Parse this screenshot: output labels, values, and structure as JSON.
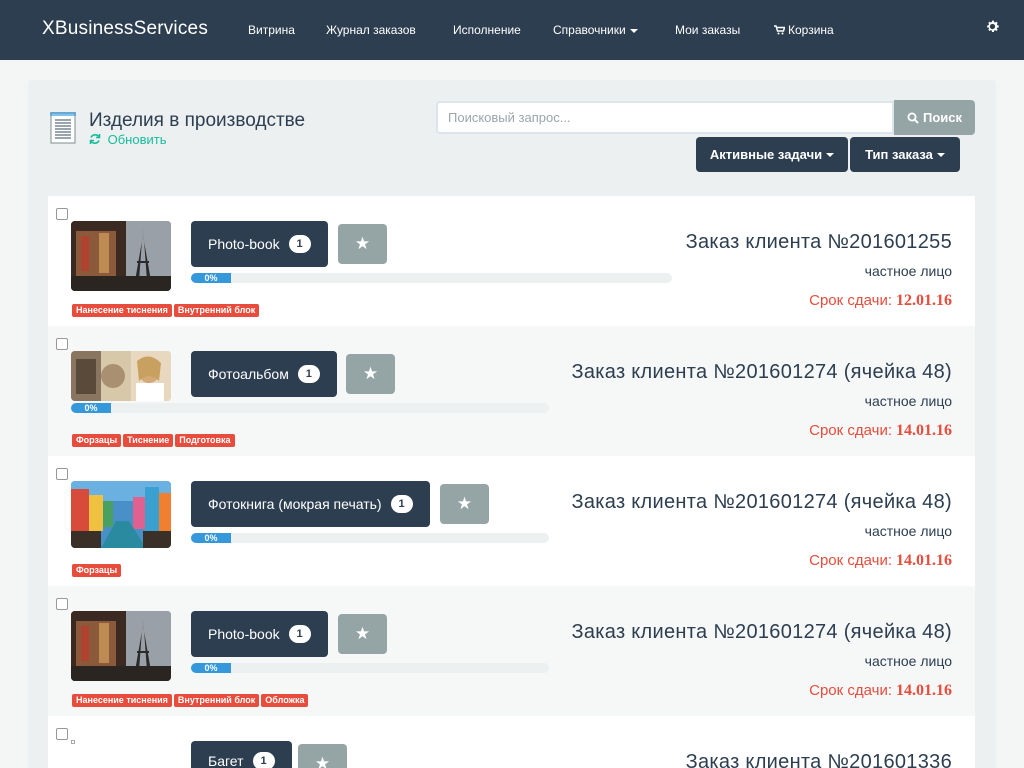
{
  "navbar": {
    "brand": "XBusinessServices",
    "items": [
      {
        "label": "Витрина"
      },
      {
        "label": "Журнал заказов"
      },
      {
        "label": "Исполнение"
      },
      {
        "label": "Справочники",
        "dropdown": true
      },
      {
        "label": "Мои заказы"
      },
      {
        "label": "Корзина",
        "icon": "cart-icon"
      }
    ],
    "settings_icon": "gear-icon"
  },
  "header": {
    "title": "Изделия в производстве",
    "refresh_label": "Обновить",
    "search_placeholder": "Поисковый запрос...",
    "search_button": "Поиск",
    "filter_active_tasks": "Активные задачи",
    "filter_order_type": "Тип заказа"
  },
  "colors": {
    "navbar": "#2c3e50",
    "accent_green": "#18bc9c",
    "danger": "#e74c3c",
    "progress": "#3498db",
    "grey_button": "#95a5a6"
  },
  "orders": [
    {
      "product": "Photo-book",
      "count": "1",
      "progress": "0%",
      "tags": [
        "Нанесение тиснения",
        "Внутренний блок"
      ],
      "order_title": "Заказ клиента №201601255",
      "client_type": "частное лицо",
      "deadline_label": "Срок сдачи:",
      "deadline_date": "12.01.16",
      "thumbnail": "carousel-eiffel"
    },
    {
      "product": "Фотоальбом",
      "count": "1",
      "progress": "0%",
      "tags": [
        "Форзацы",
        "Тиснение",
        "Подготовка"
      ],
      "order_title": "Заказ клиента №201601274 (ячейка 48)",
      "client_type": "частное лицо",
      "deadline_label": "Срок сдачи:",
      "deadline_date": "14.01.16",
      "thumbnail": "portrait-collage"
    },
    {
      "product": "Фотокнига (мокрая печать)",
      "count": "1",
      "progress": "0%",
      "tags": [
        "Форзацы"
      ],
      "order_title": "Заказ клиента №201601274 (ячейка 48)",
      "client_type": "частное лицо",
      "deadline_label": "Срок сдачи:",
      "deadline_date": "14.01.16",
      "thumbnail": "canal-houses"
    },
    {
      "product": "Photo-book",
      "count": "1",
      "progress": "0%",
      "tags": [
        "Нанесение тиснения",
        "Внутренний блок",
        "Обложка"
      ],
      "order_title": "Заказ клиента №201601274 (ячейка 48)",
      "client_type": "частное лицо",
      "deadline_label": "Срок сдачи:",
      "deadline_date": "14.01.16",
      "thumbnail": "carousel-eiffel"
    },
    {
      "product": "Багет",
      "count": "1",
      "order_title": "Заказ клиента №201601336"
    }
  ]
}
